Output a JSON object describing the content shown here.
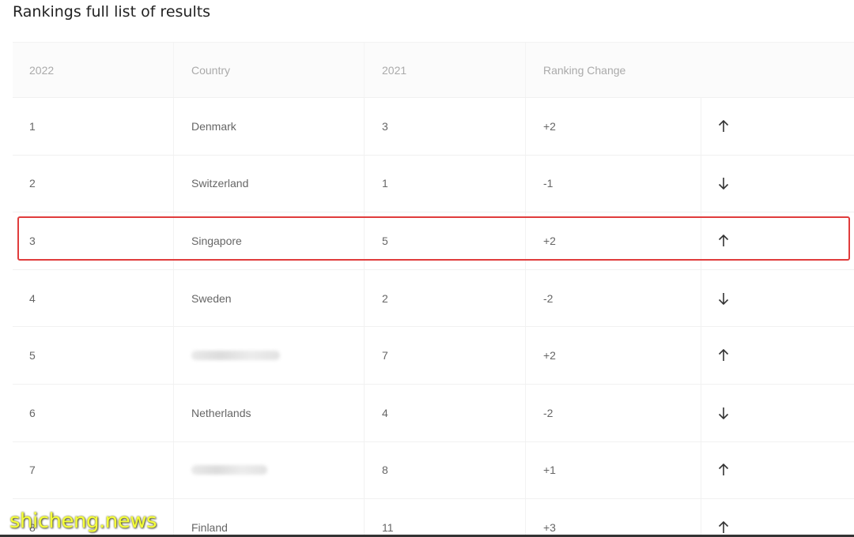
{
  "title": "Rankings full list of results",
  "headers": {
    "rank_2022": "2022",
    "country": "Country",
    "rank_2021": "2021",
    "change": "Ranking Change"
  },
  "rows": [
    {
      "rank": "1",
      "country": "Denmark",
      "prev": "3",
      "change": "+2",
      "direction": "up"
    },
    {
      "rank": "2",
      "country": "Switzerland",
      "prev": "1",
      "change": "-1",
      "direction": "down"
    },
    {
      "rank": "3",
      "country": "Singapore",
      "prev": "5",
      "change": "+2",
      "direction": "up"
    },
    {
      "rank": "4",
      "country": "Sweden",
      "prev": "2",
      "change": "-2",
      "direction": "down"
    },
    {
      "rank": "5",
      "country": "",
      "prev": "7",
      "change": "+2",
      "direction": "up"
    },
    {
      "rank": "6",
      "country": "Netherlands",
      "prev": "4",
      "change": "-2",
      "direction": "down"
    },
    {
      "rank": "7",
      "country": "",
      "prev": "8",
      "change": "+1",
      "direction": "up"
    },
    {
      "rank": "8",
      "country": "Finland",
      "prev": "11",
      "change": "+3",
      "direction": "up"
    }
  ],
  "highlight_color": "#e03c3c",
  "watermark": "shicheng.news",
  "icons": {
    "up": "arrow-up-icon",
    "down": "arrow-down-icon"
  }
}
